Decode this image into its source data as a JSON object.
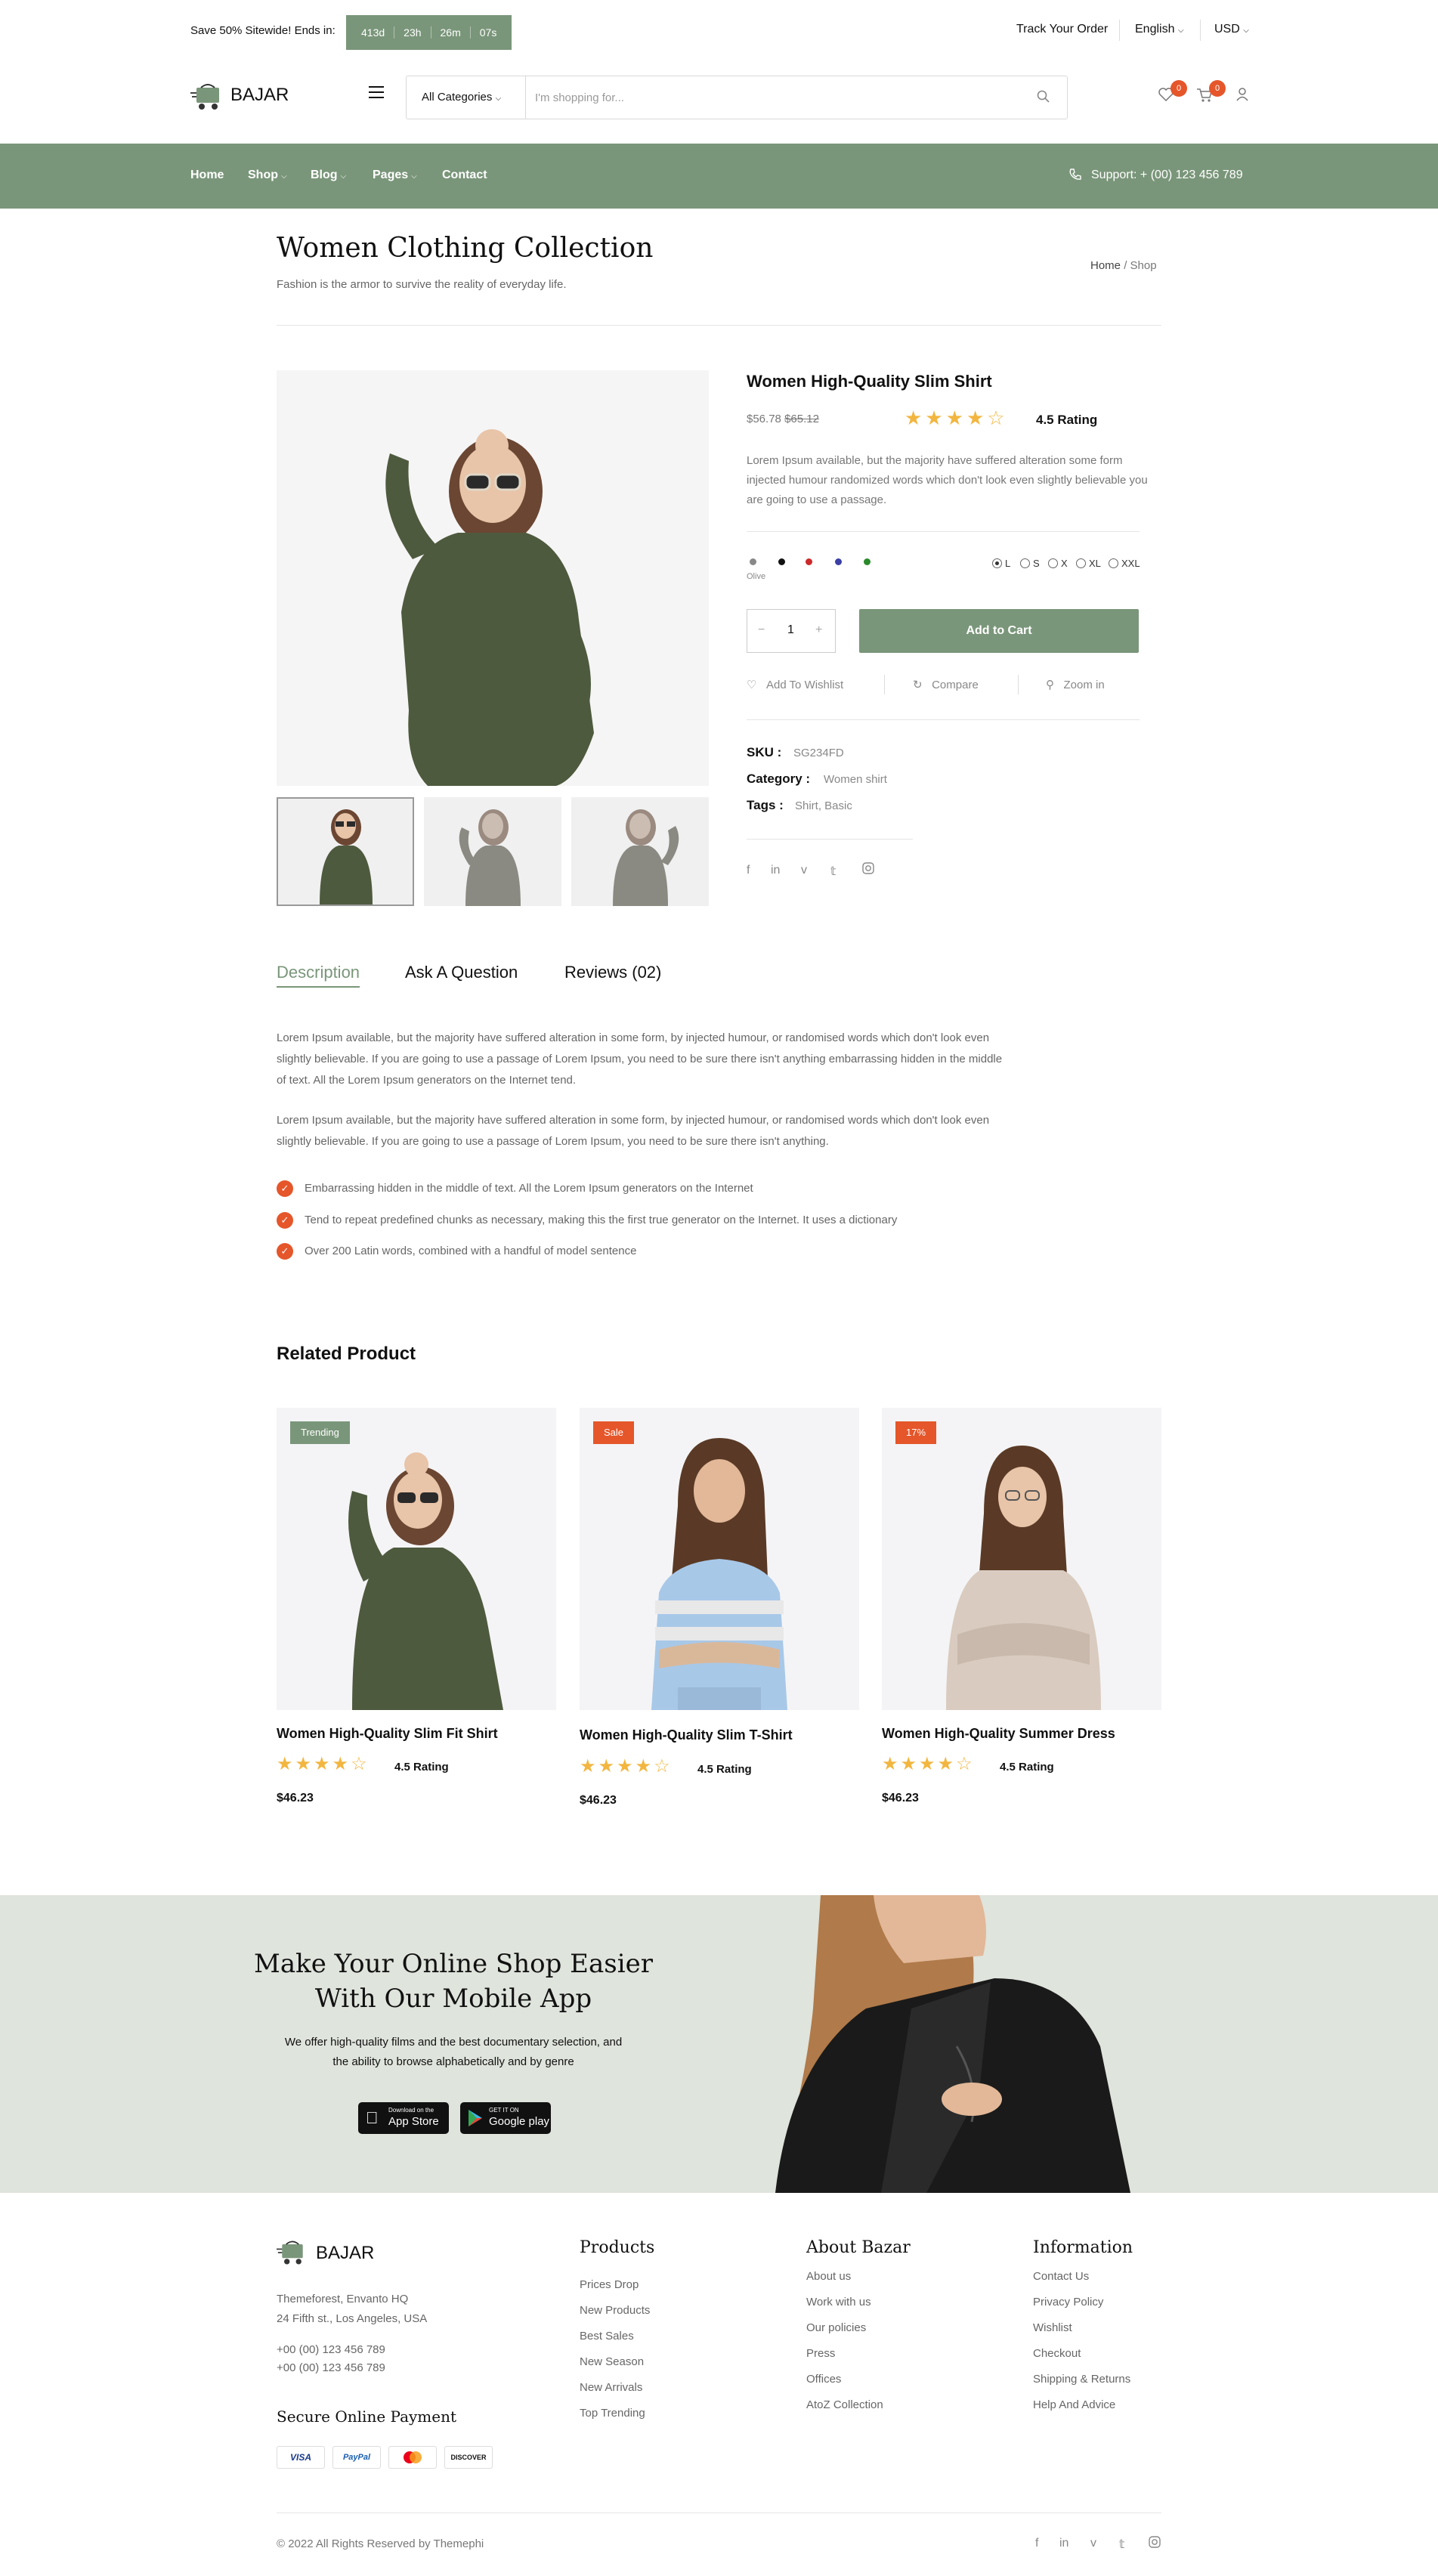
{
  "topbar": {
    "promo": "Save 50% Sitewide! Ends in:",
    "countdown": [
      "413d",
      "23h",
      "26m",
      "07s"
    ],
    "track_order": "Track Your Order",
    "language": "English",
    "currency": "USD"
  },
  "header": {
    "logo": "BAJAR",
    "category_select": "All Categories",
    "search_placeholder": "I'm shopping for...",
    "wishlist_count": "0",
    "cart_count": "0"
  },
  "nav": {
    "items": [
      {
        "label": "Home"
      },
      {
        "label": "Shop"
      },
      {
        "label": "Blog"
      },
      {
        "label": "Pages"
      },
      {
        "label": "Contact"
      }
    ],
    "support": "Support:  + (00) 123 456 789"
  },
  "page": {
    "title": "Women Clothing Collection",
    "subtitle": "Fashion is the armor to survive the reality of everyday life.",
    "breadcrumb": {
      "home": "Home",
      "sep": "/",
      "current": "Shop"
    }
  },
  "product": {
    "title": "Women High-Quality Slim Shirt",
    "price": "$56.78",
    "old_price": "$65.12",
    "rating_value": 4.5,
    "rating_text": "4.5 Rating",
    "description": "Lorem Ipsum available, but the majority have suffered alteration some form injected humour randomized words which don't look even slightly believable you are going to use a passage.",
    "color_label": "Olive",
    "colors": [
      "#888888",
      "#111111",
      "#cc2a2a",
      "#3b3fa6",
      "#2a8a2a"
    ],
    "sizes": [
      "L",
      "S",
      "X",
      "XL",
      "XXL"
    ],
    "selected_size": "L",
    "quantity": "1",
    "add_to_cart": "Add to Cart",
    "wishlist": "Add To Wishlist",
    "compare": "Compare",
    "zoom": "Zoom in",
    "sku_label": "SKU :",
    "sku": "SG234FD",
    "category_label": "Category :",
    "category": "Women shirt",
    "tags_label": "Tags :",
    "tags": "Shirt, Basic"
  },
  "tabs": [
    "Description",
    "Ask A Question",
    "Reviews (02)"
  ],
  "description": {
    "p1": "Lorem Ipsum available, but the majority have suffered alteration in some form, by injected humour, or randomised words which don't look even slightly believable. If you are going to use a passage of Lorem Ipsum, you need to be sure there isn't anything embarrassing hidden in the middle of text. All the Lorem Ipsum generators on the Internet tend.",
    "p2": "Lorem Ipsum available, but the majority have suffered alteration in some form, by injected humour, or randomised words which don't look even slightly believable. If you are going to use a passage of Lorem Ipsum, you need to be sure there isn't anything.",
    "bullets": [
      "Embarrassing hidden in the middle of text. All the Lorem Ipsum generators on the Internet",
      "Tend to repeat predefined chunks as necessary, making this the first true generator on the Internet. It uses a dictionary",
      "Over 200 Latin words, combined with a handful of model sentence"
    ]
  },
  "related": {
    "heading": "Related Product",
    "items": [
      {
        "badge": "Trending",
        "badge_color": "#7a967a",
        "title": "Women High-Quality Slim Fit Shirt",
        "rating": "4.5 Rating",
        "price": "$46.23"
      },
      {
        "badge": "Sale",
        "badge_color": "#e5562a",
        "title": "Women High-Quality Slim T-Shirt",
        "rating": "4.5 Rating",
        "price": "$46.23"
      },
      {
        "badge": "17%",
        "badge_color": "#e5562a",
        "title": "Women High-Quality Summer Dress",
        "rating": "4.5 Rating",
        "price": "$46.23"
      }
    ]
  },
  "app_banner": {
    "heading_line1": "Make Your Online Shop Easier",
    "heading_line2": "With Our Mobile App",
    "text_line1": "We offer high-quality films and the best documentary selection, and",
    "text_line2": "the ability to browse alphabetically and by genre",
    "appstore_small": "Download on the",
    "appstore": "App Store",
    "googleplay_small": "GET IT ON",
    "googleplay": "Google play"
  },
  "footer": {
    "logo": "BAJAR",
    "address1": "Themeforest, Envanto HQ",
    "address2": "24 Fifth st., Los Angeles, USA",
    "phone1": "+00 (00) 123 456 789",
    "phone2": "+00 (00) 123 456 789",
    "payment_heading": "Secure Online Payment",
    "payments": [
      "VISA",
      "PayPal",
      "MC",
      "DISCOVER"
    ],
    "columns": [
      {
        "heading": "Products",
        "links": [
          "Prices Drop",
          "New Products",
          "Best Sales",
          "New Season",
          "New Arrivals",
          "Top Trending"
        ]
      },
      {
        "heading": "About Bazar",
        "links": [
          "About us",
          "Work with us",
          "Our policies",
          "Press",
          "Offices",
          "AtoZ Collection"
        ]
      },
      {
        "heading": "Information",
        "links": [
          "Contact Us",
          "Privacy Policy",
          "Wishlist",
          "Checkout",
          "Shipping & Returns",
          "Help And Advice"
        ]
      }
    ],
    "copyright": "© 2022 All Rights Reserved by Themephi"
  }
}
